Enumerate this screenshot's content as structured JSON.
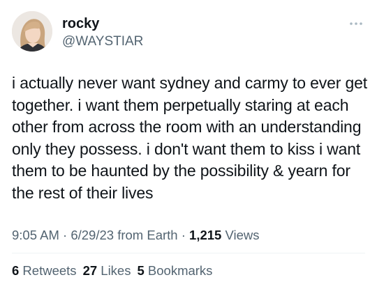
{
  "author": {
    "display_name": "rocky",
    "handle": "@WAYSTIAR",
    "avatar_icon": "profile-photo"
  },
  "menu_icon": "more-horizontal-icon",
  "tweet": {
    "lines": [
      "i actually never want sydney and carmy to ever get",
      "together. i want them perpetually staring at each",
      "other from across the room with an understanding",
      "only they possess. i don't want them to kiss i want",
      "them to be haunted by the possibility & yearn for",
      "the rest of their lives"
    ]
  },
  "meta": {
    "time": "9:05 AM",
    "sep1": " · ",
    "date": "6/29/23",
    "location": " from Earth",
    "sep2": " · ",
    "views_count": "1,215",
    "views_label": " Views"
  },
  "stats": {
    "retweets_count": "6",
    "retweets_label": " Retweets",
    "likes_count": "27",
    "likes_label": " Likes",
    "bookmarks_count": "5",
    "bookmarks_label": " Bookmarks"
  },
  "colors": {
    "text": "#0f1419",
    "secondary": "#536471",
    "divider": "#eff3f4"
  }
}
